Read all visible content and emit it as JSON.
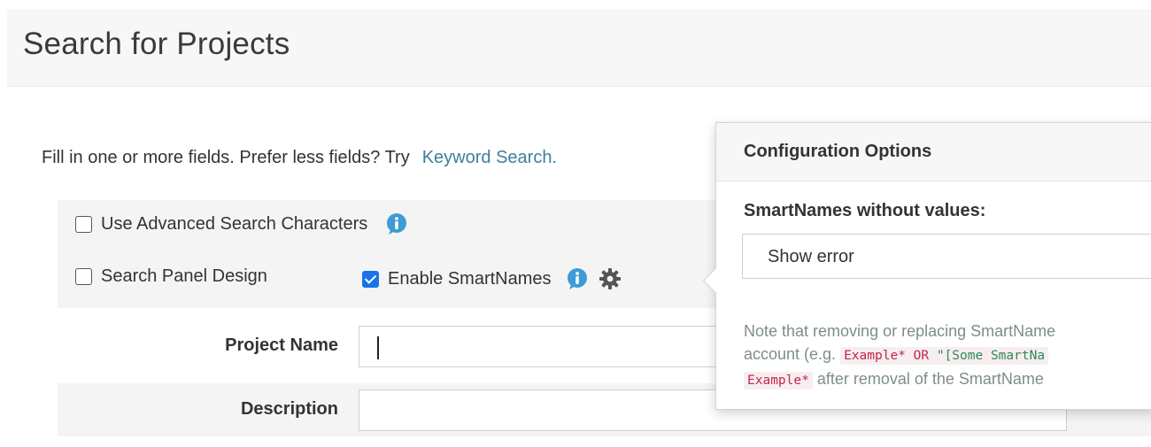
{
  "header": {
    "title": "Search for Projects"
  },
  "intro": {
    "text": "Fill in one or more fields. Prefer less fields? Try",
    "link": "Keyword Search."
  },
  "options": {
    "advanced_label": "Use Advanced Search Characters",
    "advanced_checked": false,
    "panel_label": "Search Panel Design",
    "panel_checked": false,
    "smartnames_label": "Enable SmartNames",
    "smartnames_checked": true
  },
  "fields": {
    "project_name_label": "Project Name",
    "project_name_value": "",
    "description_label": "Description",
    "description_value": ""
  },
  "popover": {
    "title": "Configuration Options",
    "label": "SmartNames without values:",
    "selected": "Show error",
    "note_line1": "Note that removing or replacing SmartName",
    "note_line2_prefix": "account (e.g.",
    "note_code1_a": "Example*",
    "note_code1_b": " OR ",
    "note_code1_c": "\"[Some SmartNa",
    "note_code2": "Example*",
    "note_line3_suffix": " after removal of the SmartName"
  },
  "icons": {
    "info": "info-icon",
    "gear": "gear-icon"
  },
  "colors": {
    "accent": "#1a73e8",
    "info": "#3d9bd6",
    "link": "#3f7f9a",
    "code": "#c7254e"
  }
}
